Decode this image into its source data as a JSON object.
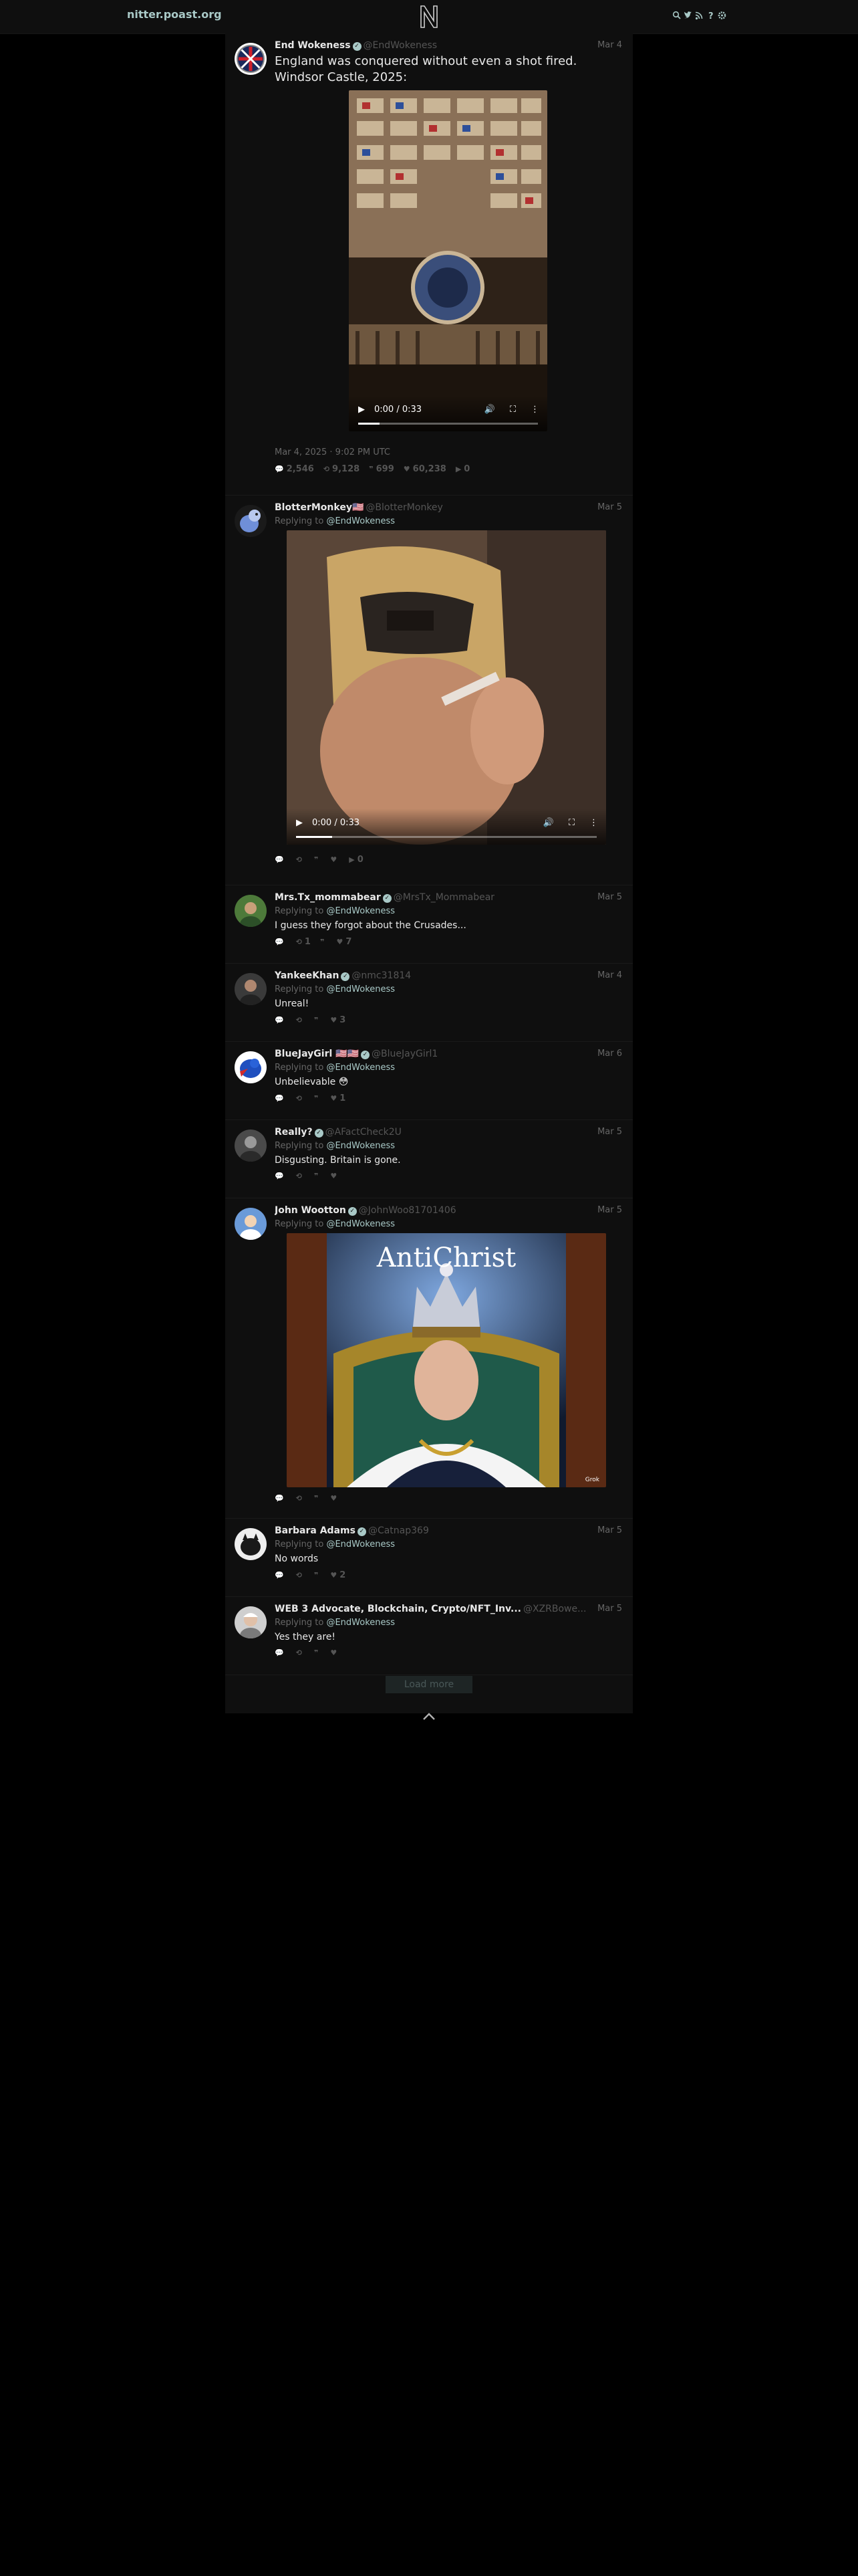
{
  "nav": {
    "site_name": "nitter.poast.org",
    "icons": [
      "search-icon",
      "twitter-icon",
      "rss-icon",
      "info-icon",
      "gear-icon"
    ]
  },
  "main_tweet": {
    "fullname": "End Wokeness",
    "username": "@EndWokeness",
    "date": "Mar 4",
    "text": "England was conquered without even a shot fired.\nWindsor Castle, 2025:",
    "video": {
      "time": "0:00 / 0:33",
      "progress": 0.12
    },
    "published": "Mar 4, 2025 · 9:02 PM UTC",
    "stats": {
      "replies": "2,546",
      "retweets": "9,128",
      "quotes": "699",
      "likes": "60,238",
      "plays": "0"
    }
  },
  "replies": [
    {
      "fullname": "BlotterMonkey🇺🇸",
      "username": "@BlotterMonkey",
      "date": "Mar 5",
      "replying_to": "@EndWokeness",
      "text": "",
      "video": {
        "time": "0:00 / 0:33",
        "progress": 0.12
      },
      "stats": {
        "replies": "",
        "retweets": "",
        "quotes": "",
        "likes": "",
        "plays": "0"
      }
    },
    {
      "fullname": "Mrs.Tx_mommabear",
      "username": "@MrsTx_Mommabear",
      "date": "Mar 5",
      "replying_to": "@EndWokeness",
      "text": "I guess they forgot about the Crusades...",
      "stats": {
        "replies": "",
        "retweets": "1",
        "quotes": "",
        "likes": "7"
      }
    },
    {
      "fullname": "YankeeKhan",
      "username": "@nmc31814",
      "date": "Mar 4",
      "replying_to": "@EndWokeness",
      "text": "Unreal!",
      "stats": {
        "replies": "",
        "retweets": "",
        "quotes": "",
        "likes": "3"
      }
    },
    {
      "fullname": "BlueJayGirl 🇺🇸🇺🇸",
      "username": "@BlueJayGirl1",
      "date": "Mar 6",
      "replying_to": "@EndWokeness",
      "text": "Unbelievable 😳",
      "stats": {
        "replies": "",
        "retweets": "",
        "quotes": "",
        "likes": "1"
      }
    },
    {
      "fullname": "Really?",
      "username": "@AFactCheck2U",
      "date": "Mar 5",
      "replying_to": "@EndWokeness",
      "text": "Disgusting. Britain is gone.",
      "stats": {
        "replies": "",
        "retweets": "",
        "quotes": "",
        "likes": ""
      }
    },
    {
      "fullname": "John Wootton",
      "username": "@JohnWoo81701406",
      "date": "Mar 5",
      "replying_to": "@EndWokeness",
      "text": "",
      "image_text": "AntiChrist",
      "image_badge": "Grok",
      "stats": {
        "replies": "",
        "retweets": "",
        "quotes": "",
        "likes": ""
      }
    },
    {
      "fullname": "Barbara Adams",
      "username": "@Catnap369",
      "date": "Mar 5",
      "replying_to": "@EndWokeness",
      "text": "No words",
      "stats": {
        "replies": "",
        "retweets": "",
        "quotes": "",
        "likes": "2"
      }
    },
    {
      "fullname": "WEB 3 Advocate, Blockchain, Crypto/NFT_Inv...",
      "username": "@XZRBowe...",
      "date": "Mar 5",
      "replying_to": "@EndWokeness",
      "text": "Yes they are!",
      "stats": {
        "replies": "",
        "retweets": "",
        "quotes": "",
        "likes": ""
      }
    }
  ],
  "labels": {
    "replying_to_prefix": "Replying to",
    "load_more": "Load more"
  },
  "colors": {
    "accent": "#a9c9c7",
    "background": "#000000",
    "panel": "#0f0f0f",
    "muted": "#555555"
  }
}
